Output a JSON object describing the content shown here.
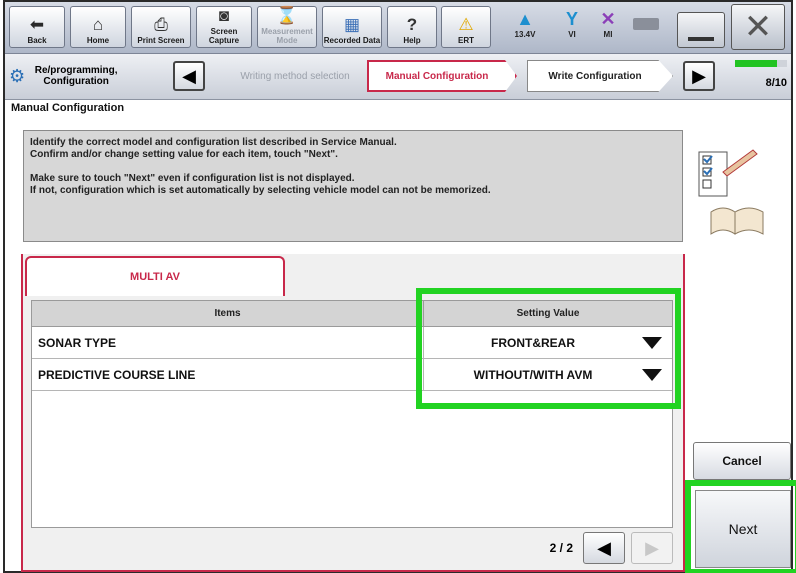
{
  "toolbar": {
    "buttons": [
      {
        "label": "Back",
        "icon": "back-arrow-icon",
        "glyph": "⬅"
      },
      {
        "label": "Home",
        "icon": "home-icon",
        "glyph": "⌂"
      },
      {
        "label": "Print Screen",
        "icon": "printer-icon",
        "glyph": "⎙"
      },
      {
        "label": "Screen Capture",
        "icon": "camera-icon",
        "glyph": "◙"
      },
      {
        "label": "Measurement Mode",
        "icon": "measurement-icon",
        "glyph": "⌛"
      },
      {
        "label": "Recorded Data",
        "icon": "recorded-data-icon",
        "glyph": "▦"
      },
      {
        "label": "Help",
        "icon": "help-icon",
        "glyph": "?"
      },
      {
        "label": "ERT",
        "icon": "warning-icon",
        "glyph": "⚠"
      }
    ],
    "status": [
      {
        "label": "13.4V",
        "icon": "car-battery-icon",
        "glyph": "🚗"
      },
      {
        "label": "VI",
        "icon": "signal-icon",
        "glyph": "▮"
      },
      {
        "label": "MI",
        "icon": "no-connection-icon",
        "glyph": "✕"
      }
    ]
  },
  "navbar": {
    "reprog_label": "Re/programming, Configuration",
    "steps": [
      "Writing method selection",
      "Manual Configuration",
      "Write Configuration"
    ],
    "progress": "8/10",
    "progress_fraction": 0.8
  },
  "page": {
    "title": "Manual Configuration"
  },
  "info": {
    "line1": "Identify the correct model and configuration list described in Service Manual.",
    "line2": "Confirm and/or change setting value for each item, touch \"Next\".",
    "line3": "Make sure to touch \"Next\" even if configuration list is not displayed.",
    "line4": "If not, configuration which is set automatically by selecting vehicle model can not be memorized."
  },
  "tab": {
    "label": "MULTI AV"
  },
  "table": {
    "headers": [
      "Items",
      "Setting Value"
    ],
    "rows": [
      {
        "item": "SONAR TYPE",
        "value": "FRONT&REAR"
      },
      {
        "item": "PREDICTIVE COURSE LINE",
        "value": "WITHOUT/WITH AVM"
      }
    ]
  },
  "pager": {
    "page": "2 / 2"
  },
  "actions": {
    "cancel": "Cancel",
    "next": "Next"
  },
  "colors": {
    "accent": "#c8284a",
    "highlight": "#22d322",
    "progress_green": "#22c322"
  }
}
